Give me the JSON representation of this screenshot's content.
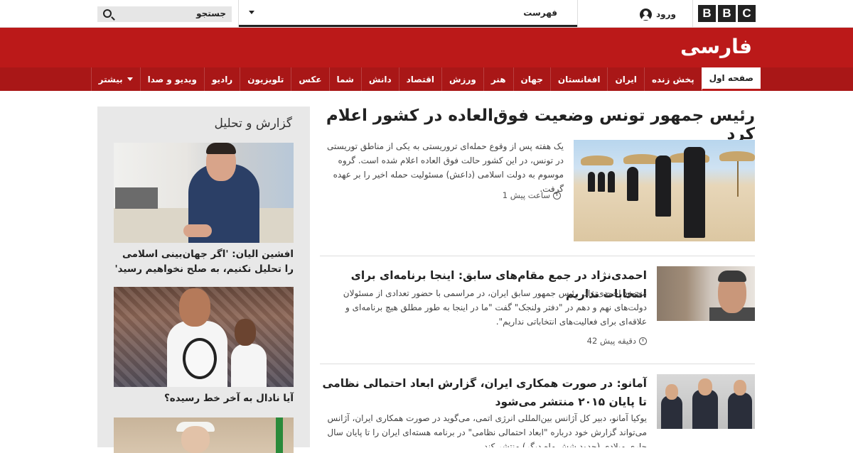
{
  "header": {
    "logo_letters": [
      "B",
      "B",
      "C"
    ],
    "signin_label": "ورود",
    "menu_label": "فهرست",
    "search_label": "جستجو"
  },
  "banner": {
    "title": "فارسی",
    "color": "#bb1919"
  },
  "nav": {
    "items": [
      {
        "label": "صفحه اول",
        "active": true
      },
      {
        "label": "پخش زنده"
      },
      {
        "label": "ایران"
      },
      {
        "label": "افغانستان"
      },
      {
        "label": "جهان"
      },
      {
        "label": "هنر"
      },
      {
        "label": "ورزش"
      },
      {
        "label": "اقتصاد"
      },
      {
        "label": "دانش"
      },
      {
        "label": "شما"
      },
      {
        "label": "عکس"
      },
      {
        "label": "تلویزیون"
      },
      {
        "label": "رادیو"
      },
      {
        "label": "ویدیو و صدا"
      }
    ],
    "more_label": "بیشتر"
  },
  "sidebar": {
    "title": "گزارش و تحلیل",
    "cards": [
      {
        "headline": "افشین الیان: 'اگر جهان‌بینی اسلامی را تحلیل نکنیم، به صلح نخواهیم رسید'"
      },
      {
        "headline": "آیا نادال به آخر خط رسیده؟"
      }
    ]
  },
  "lead": {
    "headline": "رئیس جمهور تونس وضعیت فوق‌العاده در کشور اعلام کرد",
    "summary": "یک هفته پس از وقوع حمله‌ای تروریستی به یکی از مناطق توریستی در تونس، در این کشور حالت فوق العاده اعلام شده است. گروه موسوم به دولت اسلامی (داعش) مسئولیت حمله اخیر را بر عهده گرفت.",
    "time": "1 ساعت پیش"
  },
  "stories": [
    {
      "headline": "احمدی‌نژاد در جمع مقام‌های سابق: اینجا برنامه‌ای برای انتخابات نداریم",
      "summary": "محمود احمدی‌نژاد، رئیس جمهور سابق ایران، در مراسمی با حضور تعدادی از مسئولان دولت‌های نهم و دهم در \"دفتر ولنجک\" گفت \"ما در اینجا به طور مطلق هیچ برنامه‌ای و علاقه‌ای برای فعالیت‌های انتخاباتی نداریم\".",
      "time": "42 دقیقه پیش"
    },
    {
      "headline": "آمانو: در صورت همکاری ایران، گزارش ابعاد احتمالی نظامی تا پایان ۲۰۱۵ منتشر می‌شود",
      "summary": "یوکیا آمانو، دبیر کل آژانس بین‌المللی انرژی اتمی، می‌گوید در صورت همکاری ایران، آژانس می‌تواند گزارش خود درباره \"ابعاد احتمالی نظامی\" در برنامه هسته‌ای ایران را تا پایان سال جاری میلادی (حدود شش ماه دیگر) منتشر کند."
    }
  ]
}
